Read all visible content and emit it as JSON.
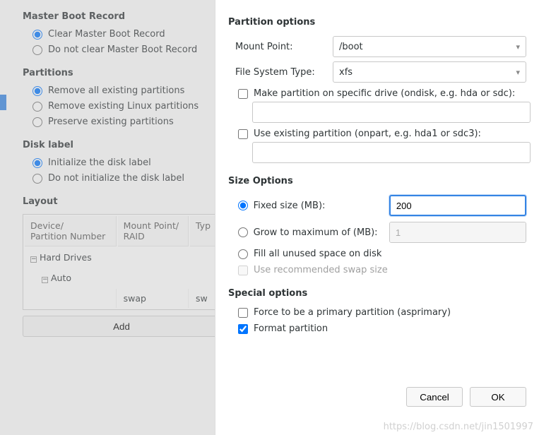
{
  "mbr": {
    "title": "Master Boot Record",
    "clear": "Clear Master Boot Record",
    "noclear": "Do not clear Master Boot Record"
  },
  "partitions": {
    "title": "Partitions",
    "remove_all": "Remove all existing partitions",
    "remove_linux": "Remove existing Linux partitions",
    "preserve": "Preserve existing partitions"
  },
  "disklabel": {
    "title": "Disk label",
    "init": "Initialize the disk label",
    "noinit": "Do not initialize the disk label"
  },
  "layout": {
    "title": "Layout",
    "col_device1": "Device/",
    "col_device2": "Partition Number",
    "col_mount1": "Mount Point/",
    "col_mount2": "RAID",
    "col_type": "Typ",
    "hard_drives": "Hard Drives",
    "auto": "Auto",
    "swap": "swap",
    "sw": "sw",
    "add": "Add"
  },
  "dialog": {
    "partopts_title": "Partition options",
    "mount_point_label": "Mount Point:",
    "mount_point_value": "/boot",
    "fs_label": "File System Type:",
    "fs_value": "xfs",
    "ondisk_label": "Make partition on specific drive (ondisk, e.g. hda or sdc):",
    "ondisk_value": "",
    "onpart_label": "Use existing partition (onpart, e.g. hda1 or sdc3):",
    "onpart_value": "",
    "size_title": "Size Options",
    "fixed_label": "Fixed size (MB):",
    "fixed_value": "200",
    "grow_label": "Grow to maximum of (MB):",
    "grow_value": "1",
    "fill_label": "Fill all unused space on disk",
    "swap_label": "Use recommended swap size",
    "special_title": "Special options",
    "asprimary_label": "Force to be a primary partition (asprimary)",
    "format_label": "Format partition",
    "cancel": "Cancel",
    "ok": "OK"
  },
  "watermark": "https://blog.csdn.net/jin1501997"
}
